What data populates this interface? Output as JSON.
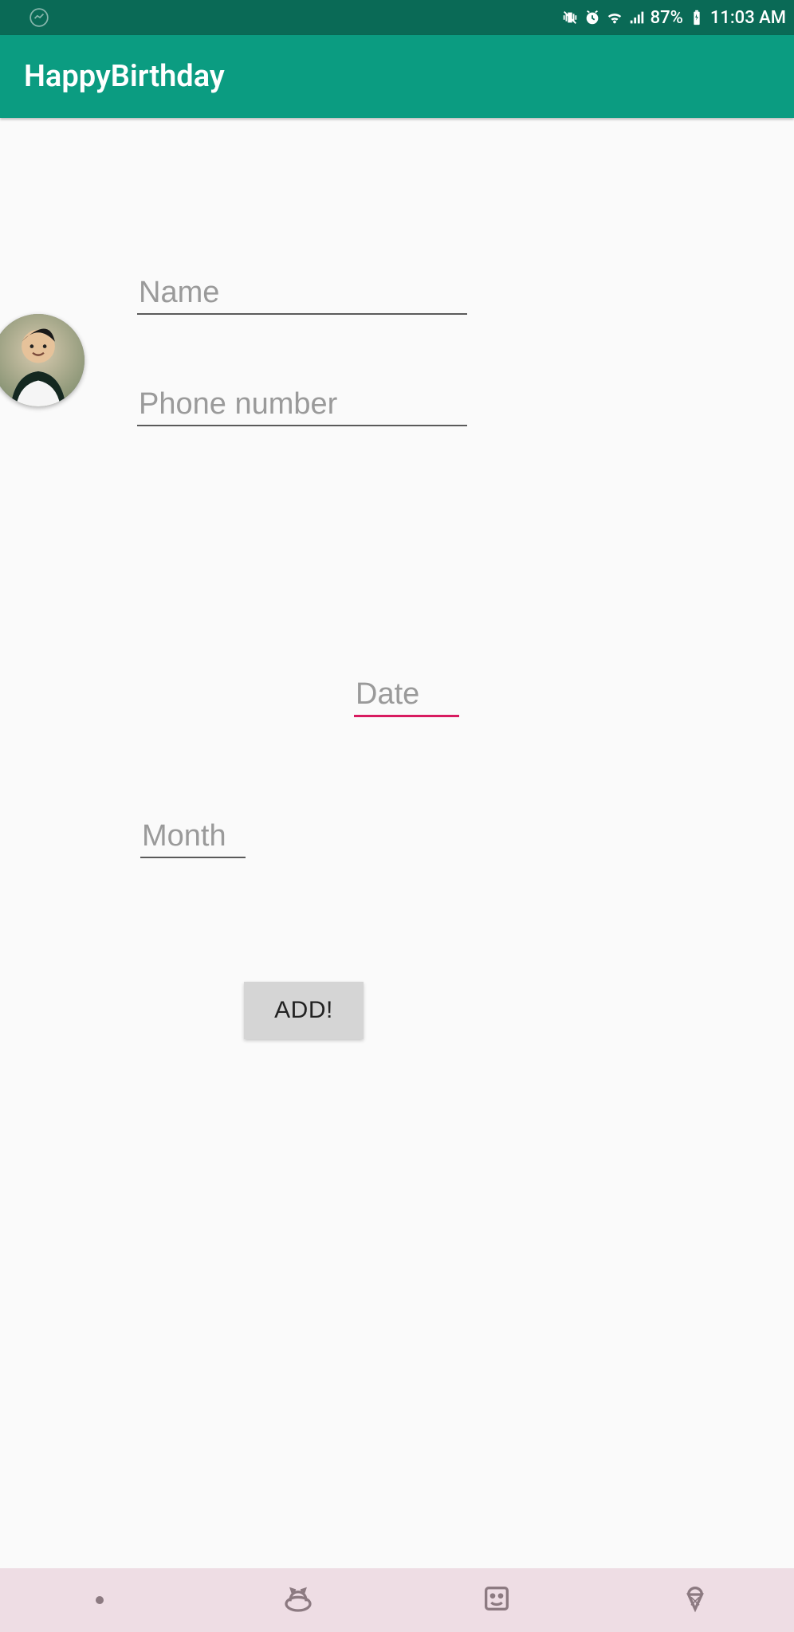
{
  "status_bar": {
    "battery": "87%",
    "time": "11:03 AM"
  },
  "app_bar": {
    "title": "HappyBirthday"
  },
  "form": {
    "name_placeholder": "Name",
    "name_value": "",
    "phone_placeholder": "Phone number",
    "phone_value": "",
    "date_placeholder": "Date",
    "date_value": "",
    "month_placeholder": "Month",
    "month_value": "",
    "add_button_label": "ADD!"
  },
  "bottom_nav": {
    "items": [
      "dot",
      "cat-icon",
      "smiley-frame-icon",
      "icecream-icon"
    ]
  }
}
